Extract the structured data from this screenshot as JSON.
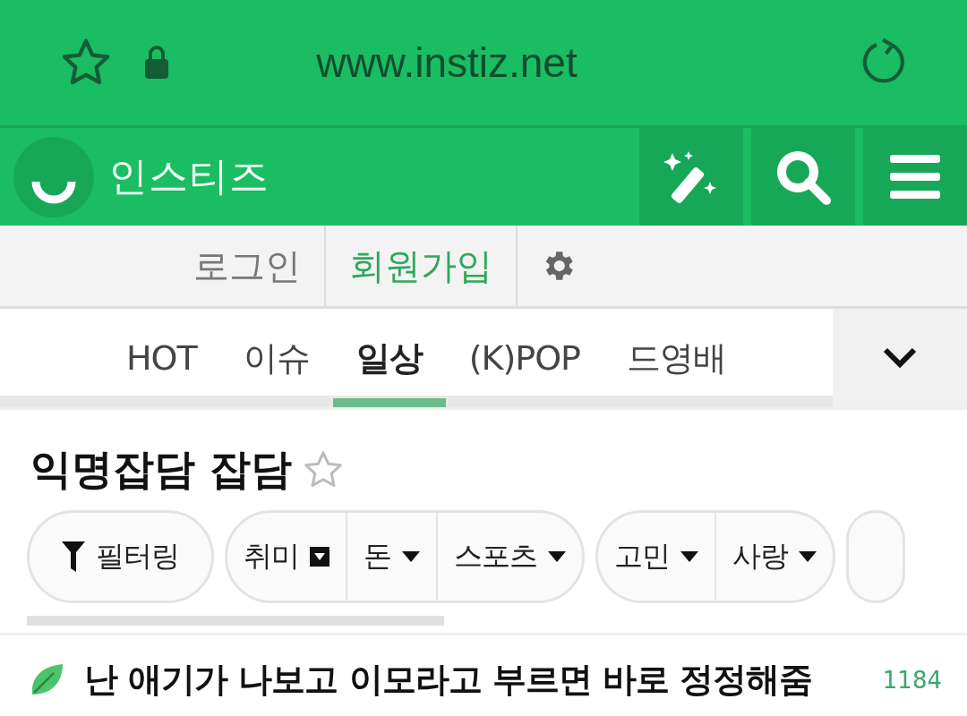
{
  "browser_bar": {
    "url": "www.instiz.net"
  },
  "header": {
    "logo_text": "인스티즈"
  },
  "account_bar": {
    "links": [
      {
        "label": "로그인",
        "kind": "plain"
      },
      {
        "label": "회원가입",
        "kind": "accent"
      }
    ]
  },
  "tabs": [
    {
      "label": "HOT",
      "selected": false
    },
    {
      "label": "이슈",
      "selected": false
    },
    {
      "label": "일상",
      "selected": true
    },
    {
      "label": "(K)POP",
      "selected": false
    },
    {
      "label": "드영배",
      "selected": false
    }
  ],
  "board": {
    "title": "익명잡담 잡담",
    "favorite": false
  },
  "filters": [
    {
      "chips": [
        {
          "label": "필터링",
          "kind": "filter"
        }
      ]
    },
    {
      "chips": [
        {
          "label": "취미",
          "kind": "box"
        },
        {
          "label": "돈",
          "kind": "caret"
        },
        {
          "label": "스포츠",
          "kind": "caret"
        }
      ]
    },
    {
      "chips": [
        {
          "label": "고민",
          "kind": "caret"
        },
        {
          "label": "사랑",
          "kind": "caret"
        }
      ]
    },
    {
      "chips": [
        {
          "kind": "cut"
        }
      ]
    }
  ],
  "posts": [
    {
      "title": "난 애기가 나보고 이모라고 부르면 바로 정정해줌",
      "count": "1184"
    }
  ]
}
